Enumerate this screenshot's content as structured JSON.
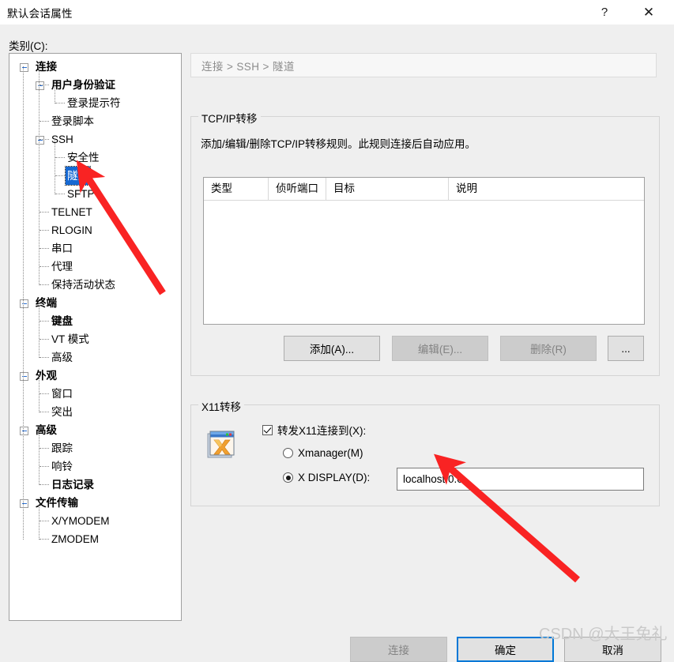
{
  "window": {
    "title": "默认会话属性",
    "help_icon": "?",
    "close_icon": "✕"
  },
  "category_label": "类别(C):",
  "tree": {
    "items": [
      {
        "label": "连接",
        "level": 0,
        "bold": true,
        "expander": true,
        "selected": false
      },
      {
        "label": "用户身份验证",
        "level": 1,
        "bold": true,
        "expander": true,
        "selected": false
      },
      {
        "label": "登录提示符",
        "level": 2,
        "bold": false,
        "expander": false,
        "selected": false
      },
      {
        "label": "登录脚本",
        "level": 1,
        "bold": false,
        "expander": false,
        "selected": false
      },
      {
        "label": "SSH",
        "level": 1,
        "bold": false,
        "expander": true,
        "selected": false
      },
      {
        "label": "安全性",
        "level": 2,
        "bold": false,
        "expander": false,
        "selected": false
      },
      {
        "label": "隧道",
        "level": 2,
        "bold": false,
        "expander": false,
        "selected": true
      },
      {
        "label": "SFTP",
        "level": 2,
        "bold": false,
        "expander": false,
        "selected": false
      },
      {
        "label": "TELNET",
        "level": 1,
        "bold": false,
        "expander": false,
        "selected": false
      },
      {
        "label": "RLOGIN",
        "level": 1,
        "bold": false,
        "expander": false,
        "selected": false
      },
      {
        "label": "串口",
        "level": 1,
        "bold": false,
        "expander": false,
        "selected": false
      },
      {
        "label": "代理",
        "level": 1,
        "bold": false,
        "expander": false,
        "selected": false
      },
      {
        "label": "保持活动状态",
        "level": 1,
        "bold": false,
        "expander": false,
        "selected": false
      },
      {
        "label": "终端",
        "level": 0,
        "bold": true,
        "expander": true,
        "selected": false
      },
      {
        "label": "键盘",
        "level": 1,
        "bold": true,
        "expander": false,
        "selected": false
      },
      {
        "label": "VT 模式",
        "level": 1,
        "bold": false,
        "expander": false,
        "selected": false
      },
      {
        "label": "高级",
        "level": 1,
        "bold": false,
        "expander": false,
        "selected": false
      },
      {
        "label": "外观",
        "level": 0,
        "bold": true,
        "expander": true,
        "selected": false
      },
      {
        "label": "窗口",
        "level": 1,
        "bold": false,
        "expander": false,
        "selected": false
      },
      {
        "label": "突出",
        "level": 1,
        "bold": false,
        "expander": false,
        "selected": false
      },
      {
        "label": "高级",
        "level": 0,
        "bold": true,
        "expander": true,
        "selected": false
      },
      {
        "label": "跟踪",
        "level": 1,
        "bold": false,
        "expander": false,
        "selected": false
      },
      {
        "label": "响铃",
        "level": 1,
        "bold": false,
        "expander": false,
        "selected": false
      },
      {
        "label": "日志记录",
        "level": 1,
        "bold": true,
        "expander": false,
        "selected": false
      },
      {
        "label": "文件传输",
        "level": 0,
        "bold": true,
        "expander": true,
        "selected": false
      },
      {
        "label": "X/YMODEM",
        "level": 1,
        "bold": false,
        "expander": false,
        "selected": false
      },
      {
        "label": "ZMODEM",
        "level": 1,
        "bold": false,
        "expander": false,
        "selected": false
      }
    ]
  },
  "breadcrumb": {
    "text": "连接 > SSH > 隧道"
  },
  "tcpip_group": {
    "legend": "TCP/IP转移",
    "description": "添加/编辑/删除TCP/IP转移规则。此规则连接后自动应用。",
    "columns": [
      "类型",
      "侦听端口",
      "目标",
      "说明"
    ],
    "rows": [],
    "buttons": {
      "add": "添加(A)...",
      "edit": "编辑(E)...",
      "delete": "删除(R)",
      "more": "..."
    }
  },
  "x11_group": {
    "legend": "X11转移",
    "icon": "xmanager-app-icon",
    "forward_checkbox": {
      "label": "转发X11连接到(X):",
      "checked": true
    },
    "options": [
      {
        "label": "Xmanager(M)",
        "selected": false
      },
      {
        "label": "X DISPLAY(D):",
        "selected": true
      }
    ],
    "display_value": "localhost:0.0"
  },
  "footer_buttons": {
    "connect": "连接",
    "ok": "确定",
    "cancel": "取消"
  },
  "watermark": "CSDN @大王免礼",
  "colors": {
    "dialog_bg": "#efefef",
    "selection_blue": "#1669d3",
    "focus_blue": "#0078d7",
    "annotation_red": "#f92323",
    "breadcrumb_text": "#8c8c8c"
  }
}
